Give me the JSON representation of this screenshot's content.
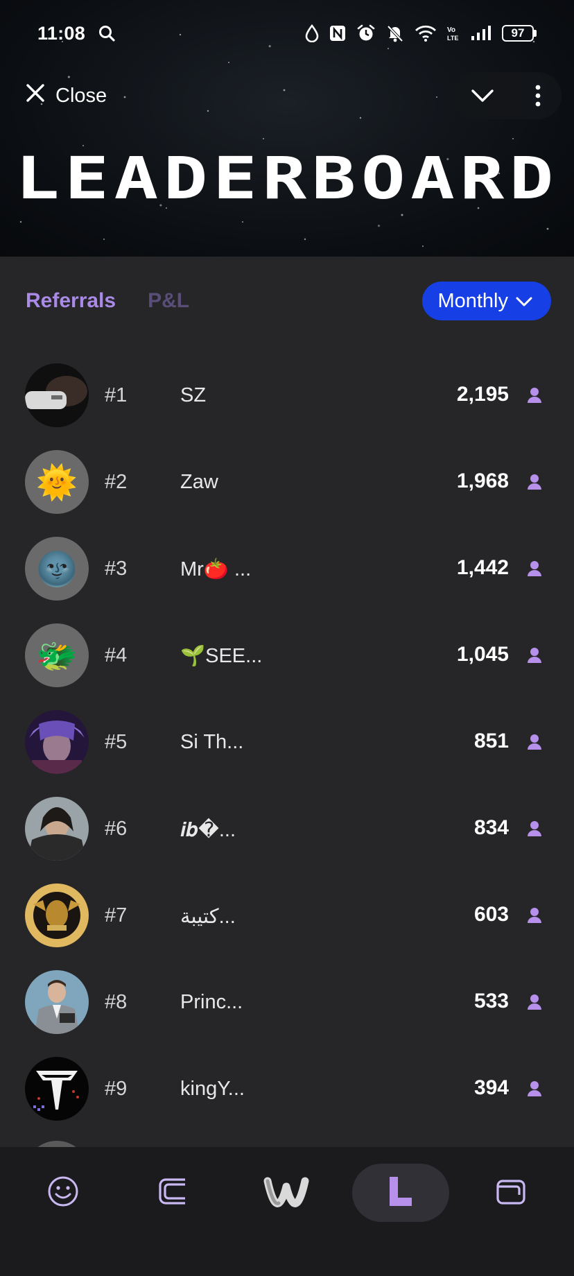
{
  "status_bar": {
    "time": "11:08",
    "battery": "97",
    "icons": [
      "search-icon",
      "drop-icon",
      "nfc-icon",
      "alarm-icon",
      "mute-icon",
      "wifi-icon",
      "volte-icon",
      "signal-icon",
      "battery-icon"
    ]
  },
  "header": {
    "close_label": "Close",
    "title": "LEADERBOARD",
    "actions": [
      "chevron-down-icon",
      "more-vertical-icon"
    ]
  },
  "tabs": [
    {
      "label": "Referrals",
      "active": true
    },
    {
      "label": "P&L",
      "active": false
    }
  ],
  "period_select": {
    "value": "Monthly"
  },
  "leaderboard": [
    {
      "rank": "#1",
      "name": "SZ",
      "score": "2,195",
      "avatar": "photo-hand"
    },
    {
      "rank": "#2",
      "name": "Zaw",
      "score": "1,968",
      "avatar": "🌞"
    },
    {
      "rank": "#3",
      "name": "Mr🍅 ...",
      "score": "1,442",
      "avatar": "🌚"
    },
    {
      "rank": "#4",
      "name": "🌱SEE...",
      "score": "1,045",
      "avatar": "🐲"
    },
    {
      "rank": "#5",
      "name": "Si Th...",
      "score": "851",
      "avatar": "anime-photo"
    },
    {
      "rank": "#6",
      "name": "𝒊𝒃�...",
      "score": "834",
      "avatar": "portrait-photo"
    },
    {
      "rank": "#7",
      "name": "كتيبة...",
      "score": "603",
      "avatar": "lion-emblem"
    },
    {
      "rank": "#8",
      "name": "Princ...",
      "score": "533",
      "avatar": "suit-photo"
    },
    {
      "rank": "#9",
      "name": "kingY...",
      "score": "394",
      "avatar": "logo-t"
    }
  ],
  "bottom_nav": [
    {
      "icon": "smiley-icon",
      "active": false
    },
    {
      "icon": "bracket-icon",
      "active": false
    },
    {
      "icon": "w-logo-icon",
      "active": false
    },
    {
      "icon": "leaderboard-l-icon",
      "active": true
    },
    {
      "icon": "wallet-icon",
      "active": false
    }
  ],
  "colors": {
    "background": "#262628",
    "accent_purple": "#a98ae6",
    "select_blue": "#1640e6",
    "nav_background": "#1b1b1d"
  }
}
